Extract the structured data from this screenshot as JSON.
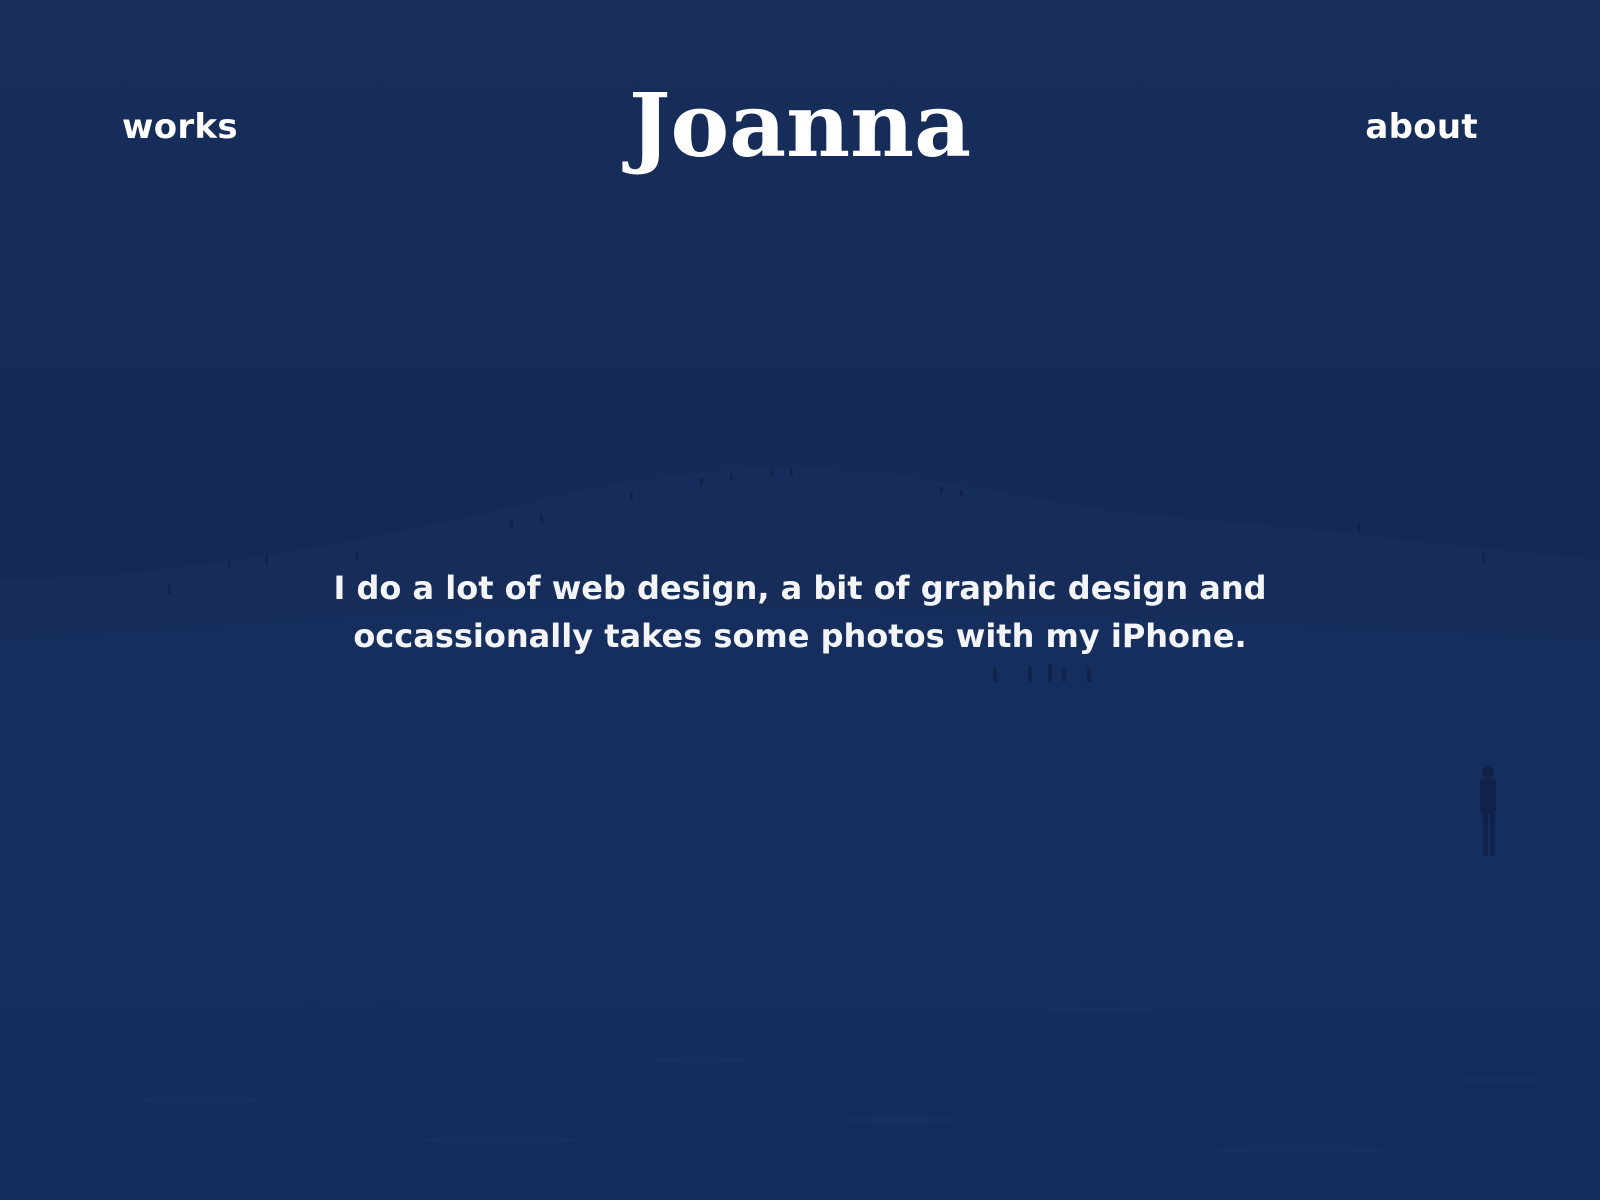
{
  "header": {
    "nav_left_label": "works",
    "site_title": "Joanna",
    "nav_right_label": "about"
  },
  "hero": {
    "background_image": "sand-dune-photo",
    "overlay_color": "#142a56",
    "intro_text": "I do a lot of web design, a bit of graphic design and occassionally takes some photos with my iPhone."
  }
}
